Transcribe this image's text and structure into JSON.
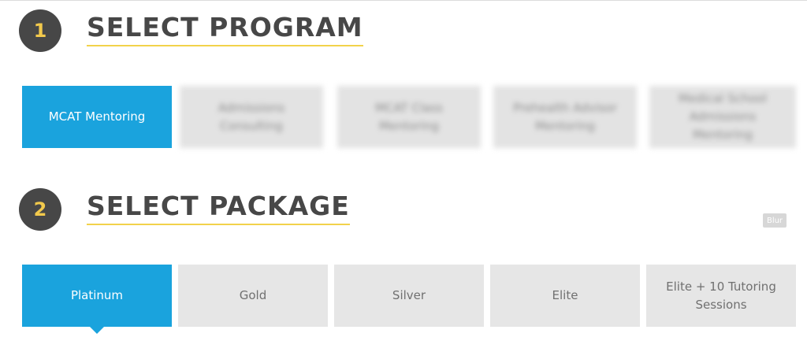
{
  "step1": {
    "number": "1",
    "title": "SELECT PROGRAM"
  },
  "programs": [
    {
      "label": "MCAT Mentoring",
      "active": true,
      "blurred": false
    },
    {
      "label": "Admissions Consulting",
      "active": false,
      "blurred": true
    },
    {
      "label": "MCAT Class Mentoring",
      "active": false,
      "blurred": true
    },
    {
      "label": "Prehealth Advisor Mentoring",
      "active": false,
      "blurred": true
    },
    {
      "label": "Medical School Admissions Mentoring",
      "active": false,
      "blurred": true
    }
  ],
  "step2": {
    "number": "2",
    "title": "SELECT PACKAGE"
  },
  "blur_badge": "Blur",
  "packages": [
    {
      "label": "Platinum",
      "active": true
    },
    {
      "label": "Gold",
      "active": false
    },
    {
      "label": "Silver",
      "active": false
    },
    {
      "label": "Elite",
      "active": false
    },
    {
      "label": "Elite + 10 Tutoring Sessions",
      "active": false
    }
  ],
  "colors": {
    "accent": "#1aa3dd",
    "dark": "#474747",
    "highlight": "#f2d24b",
    "tile": "#e6e6e6"
  }
}
